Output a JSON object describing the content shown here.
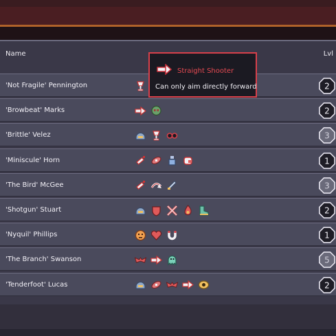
{
  "header": {
    "name_label": "Name",
    "level_label": "Lvl"
  },
  "tooltip": {
    "title": "Straight Shooter",
    "description": "Can only aim directly forward",
    "icon": "arrow-right-icon"
  },
  "colors": {
    "accent_red": "#d8404a",
    "row_bg": "#4a4a5c",
    "panel_bg": "#3a3848"
  },
  "rows": [
    {
      "name": "'Not Fragile' Pennington",
      "level": "2",
      "traits": [
        "goblet-icon"
      ]
    },
    {
      "name": "'Browbeat' Marks",
      "level": "2",
      "traits": [
        "arrow-right-icon",
        "green-skull-icon"
      ]
    },
    {
      "name": "'Brittle' Velez",
      "level": "3",
      "traits": [
        "helmet-icon",
        "goblet-icon",
        "goggles-icon"
      ]
    },
    {
      "name": "'Miniscule' Horn",
      "level": "1",
      "traits": [
        "syringe-icon",
        "bandage-icon",
        "bottle-icon",
        "fist-icon"
      ]
    },
    {
      "name": "'The Bird' McGee",
      "level": "3",
      "traits": [
        "syringe-icon",
        "curved-arrow-icon",
        "knife-icon"
      ]
    },
    {
      "name": "'Shotgun' Stuart",
      "level": "2",
      "traits": [
        "helmet-icon",
        "shield-icon",
        "crossed-swords-icon",
        "flame-icon",
        "boot-icon"
      ]
    },
    {
      "name": "'Nyquil' Phillips",
      "level": "1",
      "traits": [
        "face-icon",
        "heart-icon",
        "magnet-icon"
      ]
    },
    {
      "name": "'The Branch' Swanson",
      "level": "5",
      "traits": [
        "bat-icon",
        "arrow-right-icon",
        "ghost-icon"
      ]
    },
    {
      "name": "'Tenderfoot' Lucas",
      "level": "2",
      "traits": [
        "helmet-icon",
        "bandage-icon",
        "bat-icon",
        "arrow-right-icon",
        "eye-icon"
      ]
    }
  ]
}
